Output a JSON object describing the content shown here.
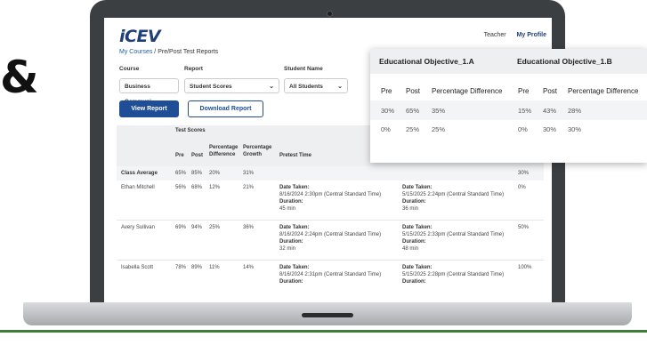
{
  "header": {
    "logo": "iCEV",
    "teacher": "Teacher",
    "my_profile": "My Profile"
  },
  "breadcrumb": {
    "link": "My Courses",
    "separator": " / ",
    "current": "Pre/Post Test Reports"
  },
  "filters": {
    "course_label": "Course",
    "course_value": "Business Communi",
    "report_label": "Report",
    "report_value": "Student Scores",
    "student_label": "Student Name",
    "student_value": "All Students"
  },
  "buttons": {
    "view_report": "View Report",
    "download_report": "Download Report"
  },
  "table": {
    "group_header": "Test Scores",
    "columns": {
      "pre": "Pre",
      "post": "Post",
      "pct_diff_1": "Percentage",
      "pct_diff_2": "Difference",
      "pct_growth_1": "Percentage",
      "pct_growth_2": "Growth",
      "pretest_time": "Pretest Time"
    },
    "class_average": {
      "label": "Class Average",
      "pre": "65%",
      "post": "85%",
      "diff": "20%",
      "growth": "31%",
      "right": "30%"
    },
    "rows": [
      {
        "name": "Ethan Mitchell",
        "pre": "56%",
        "post": "68%",
        "diff": "12%",
        "growth": "21%",
        "date_label": "Date Taken:",
        "pre_date": "8/16/2024 2:30pm (Central Standard Time)",
        "duration_label": "Duration:",
        "pre_duration": "45 min",
        "post_date": "5/15/2025 2:24pm (Central Standard Time)",
        "post_duration": "36 min",
        "right": "0%"
      },
      {
        "name": "Avery Sullivan",
        "pre": "69%",
        "post": "94%",
        "diff": "25%",
        "growth": "36%",
        "date_label": "Date Taken:",
        "pre_date": "8/16/2024 2:24pm (Central Standard Time)",
        "duration_label": "Duration:",
        "pre_duration": "32 min",
        "post_date": "5/15/2025 2:33pm (Central Standard Time)",
        "post_duration": "48 min",
        "right": "50%"
      },
      {
        "name": "Isabella Scott",
        "pre": "78%",
        "post": "89%",
        "diff": "11%",
        "growth": "14%",
        "date_label": "Date Taken:",
        "pre_date": "8/16/2024 2:31pm (Central Standard Time)",
        "duration_label": "Duration:",
        "post_date": "5/15/2025 2:28pm (Central Standard Time)",
        "right": "100%"
      }
    ]
  },
  "objectives_card": {
    "obj_a": "Educational Objective_1.A",
    "obj_b": "Educational Objective_1.B",
    "headers": {
      "pre": "Pre",
      "post": "Post",
      "diff": "Percentage Difference"
    },
    "rows": [
      {
        "a_pre": "30%",
        "a_post": "65%",
        "a_diff": "35%",
        "b_pre": "15%",
        "b_post": "43%",
        "b_diff": "28%"
      },
      {
        "a_pre": "0%",
        "a_post": "25%",
        "a_diff": "25%",
        "b_pre": "0%",
        "b_post": "30%",
        "b_diff": "30%"
      }
    ]
  },
  "decor": {
    "ampersand": "&"
  },
  "colors": {
    "brand_blue": "#1f4e97",
    "laptop_frame": "#3c3f42",
    "ground_line": "#3f7d3a"
  }
}
